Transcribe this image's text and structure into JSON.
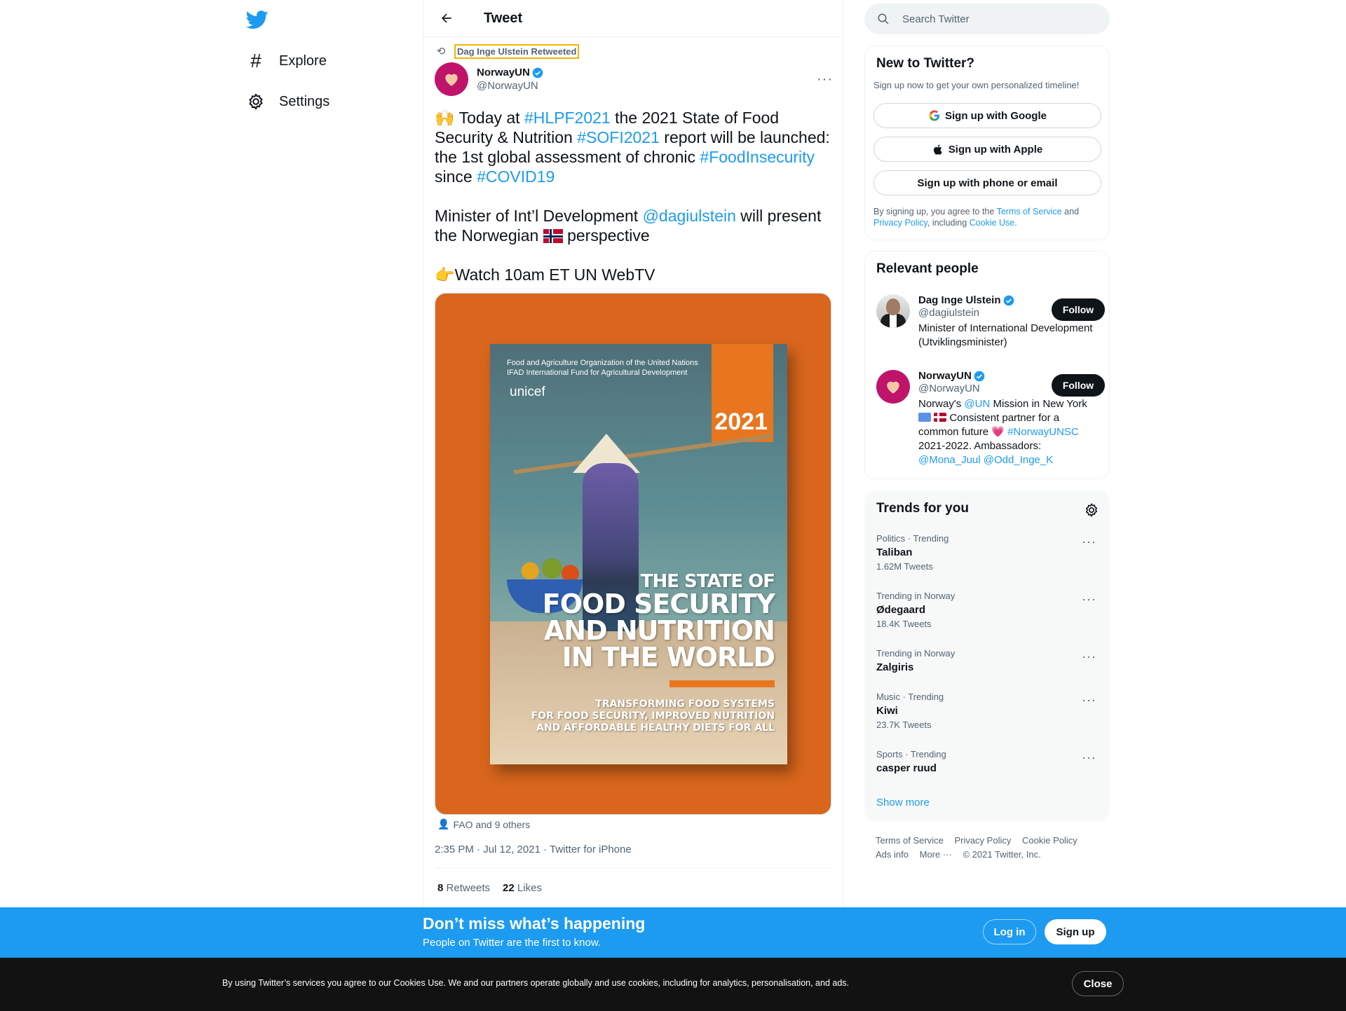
{
  "nav": {
    "logo_icon": "twitter-bird-icon",
    "items": [
      {
        "icon": "hashtag-icon",
        "label": "Explore"
      },
      {
        "icon": "gear-icon",
        "label": "Settings"
      }
    ]
  },
  "header": {
    "title": "Tweet"
  },
  "tweet": {
    "retweeted_by": "Dag Inge Ulstein Retweeted",
    "author_name": "NorwayUN",
    "author_handle": "@NorwayUN",
    "text": {
      "p1_emoji": "🙌",
      "p1_a": " Today at ",
      "p1_tag1": "#HLPF2021",
      "p1_b": " the 2021 State of Food Security & Nutrition ",
      "p1_tag2": "#SOFI2021",
      "p1_c": " report will be launched: the 1st global assessment of chronic ",
      "p1_tag3": "#FoodInsecurity",
      "p1_d": " since ",
      "p1_tag4": "#COVID19",
      "p2_a": "Minister of Int’l Development ",
      "p2_mention": "@dagiulstein",
      "p2_b": " will present the Norwegian ",
      "p2_c": " perspective",
      "p3_emoji": "👉",
      "p3_text": "Watch 10am ET UN WebTV"
    },
    "media": {
      "year": "2021",
      "logos_line1": "Food and Agriculture Organization of the United Nations      IFAD International Fund for Agricultural Development",
      "logos_line2": "unicef",
      "title_l1": "THE STATE OF",
      "title_l2": "FOOD SECURITY",
      "title_l3": "AND NUTRITION",
      "title_l4": "IN THE WORLD",
      "sub_l1": "TRANSFORMING FOOD SYSTEMS",
      "sub_l2": "FOR FOOD SECURITY, IMPROVED NUTRITION",
      "sub_l3": "AND AFFORDABLE HEALTHY DIETS FOR ALL"
    },
    "tagged": "FAO and 9 others",
    "timestamp": "2:35 PM · Jul 12, 2021 · Twitter for iPhone",
    "retweets_count": "8",
    "retweets_label": "Retweets",
    "likes_count": "22",
    "likes_label": "Likes"
  },
  "search": {
    "placeholder": "Search Twitter"
  },
  "new_to_twitter": {
    "title": "New to Twitter?",
    "subtitle": "Sign up now to get your own personalized timeline!",
    "google": "Sign up with Google",
    "apple": "Sign up with Apple",
    "phone": "Sign up with phone or email",
    "terms_a": "By signing up, you agree to the ",
    "terms_link": "Terms of Service",
    "terms_b": " and ",
    "privacy_link": "Privacy Policy",
    "terms_c": ", including ",
    "cookie_link": "Cookie Use."
  },
  "relevant_people": {
    "title": "Relevant people",
    "people": [
      {
        "name": "Dag Inge Ulstein",
        "handle": "@dagiulstein",
        "bio": "Minister of International Development (Utviklingsminister)",
        "follow": "Follow"
      },
      {
        "name": "NorwayUN",
        "handle": "@NorwayUN",
        "bio_a": "Norway's ",
        "bio_un": "@UN",
        "bio_b": " Mission in New York ",
        "bio_c": " Consistent partner for a common future ",
        "bio_heart": "💗",
        "bio_tag": " #NorwayUNSC",
        "bio_d": " 2021-2022. Ambassadors: ",
        "bio_m1": "@Mona_Juul",
        "bio_m2": " @Odd_Inge_K",
        "follow": "Follow"
      }
    ]
  },
  "trends": {
    "title": "Trends for you",
    "items": [
      {
        "meta": "Politics · Trending",
        "name": "Taliban",
        "count": "1.62M Tweets"
      },
      {
        "meta": "Trending in Norway",
        "name": "Ødegaard",
        "count": "18.4K Tweets"
      },
      {
        "meta": "Trending in Norway",
        "name": "Zalgiris",
        "count": ""
      },
      {
        "meta": "Music · Trending",
        "name": "Kiwi",
        "count": "23.7K Tweets"
      },
      {
        "meta": "Sports · Trending",
        "name": "casper ruud",
        "count": ""
      }
    ],
    "show_more": "Show more"
  },
  "footer": {
    "terms": "Terms of Service",
    "privacy": "Privacy Policy",
    "cookie": "Cookie Policy",
    "ads": "Ads info",
    "more": "More ···",
    "copyright": "© 2021 Twitter, Inc."
  },
  "bottom_bar": {
    "title": "Don’t miss what’s happening",
    "subtitle": "People on Twitter are the first to know.",
    "login": "Log in",
    "signup": "Sign up"
  },
  "cookie_bar": {
    "text": "By using Twitter’s services you agree to our Cookies Use. We and our partners operate globally and use cookies, including for analytics, personalisation, and ads.",
    "close": "Close"
  },
  "colors": {
    "accent": "#1d9bf0",
    "text": "#0f1419",
    "muted": "#536471",
    "cookie_bg": "#121212"
  }
}
